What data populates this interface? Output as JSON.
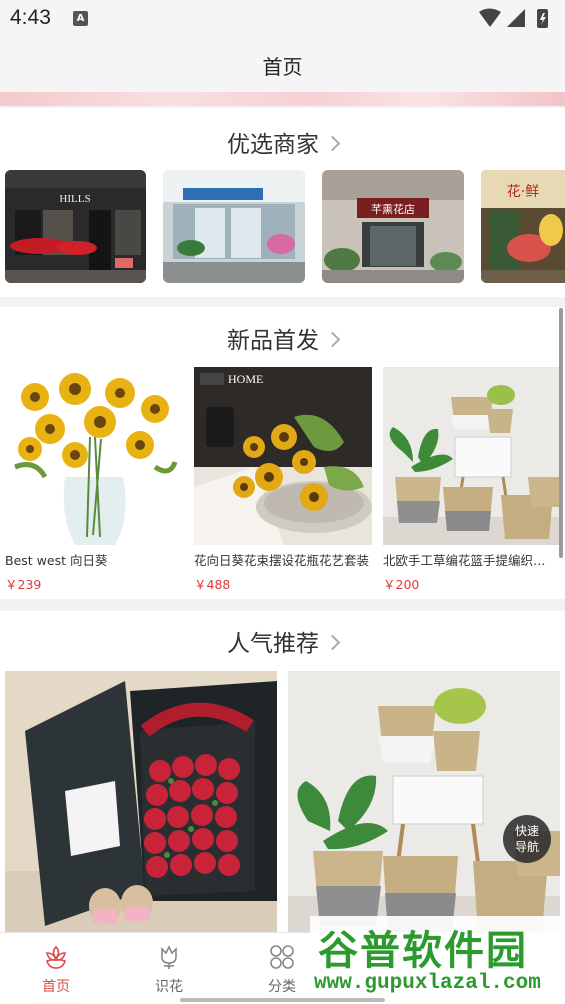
{
  "status": {
    "time": "4:43",
    "notification_badge": "A"
  },
  "nav": {
    "title": "首页"
  },
  "sections": {
    "merchants": {
      "title": "优选商家",
      "shops": [
        "HILLS",
        "",
        "芊熏花店",
        "花·鲜"
      ]
    },
    "new_products": {
      "title": "新品首发",
      "image_tag": "HOME",
      "items": [
        {
          "name": "Best west 向日葵",
          "price": "￥239"
        },
        {
          "name": "花向日葵花束摆设花瓶花艺套装",
          "price": "￥488"
        },
        {
          "name": "北欧手工草编花篮手提编织篮子",
          "price": "￥200"
        }
      ]
    },
    "popular": {
      "title": "人气推荐"
    }
  },
  "float_nav": {
    "line1": "快速",
    "line2": "导航"
  },
  "tabs": [
    {
      "label": "首页",
      "icon": "flower-home-icon",
      "active": true
    },
    {
      "label": "识花",
      "icon": "tulip-icon",
      "active": false
    },
    {
      "label": "分类",
      "icon": "grid-icon",
      "active": false
    }
  ],
  "watermark": {
    "title": "谷普软件园",
    "url": "www.gupuxlazal.com"
  },
  "colors": {
    "accent": "#e24b4b",
    "price": "#e2393c",
    "watermark": "#2c9a2c"
  }
}
